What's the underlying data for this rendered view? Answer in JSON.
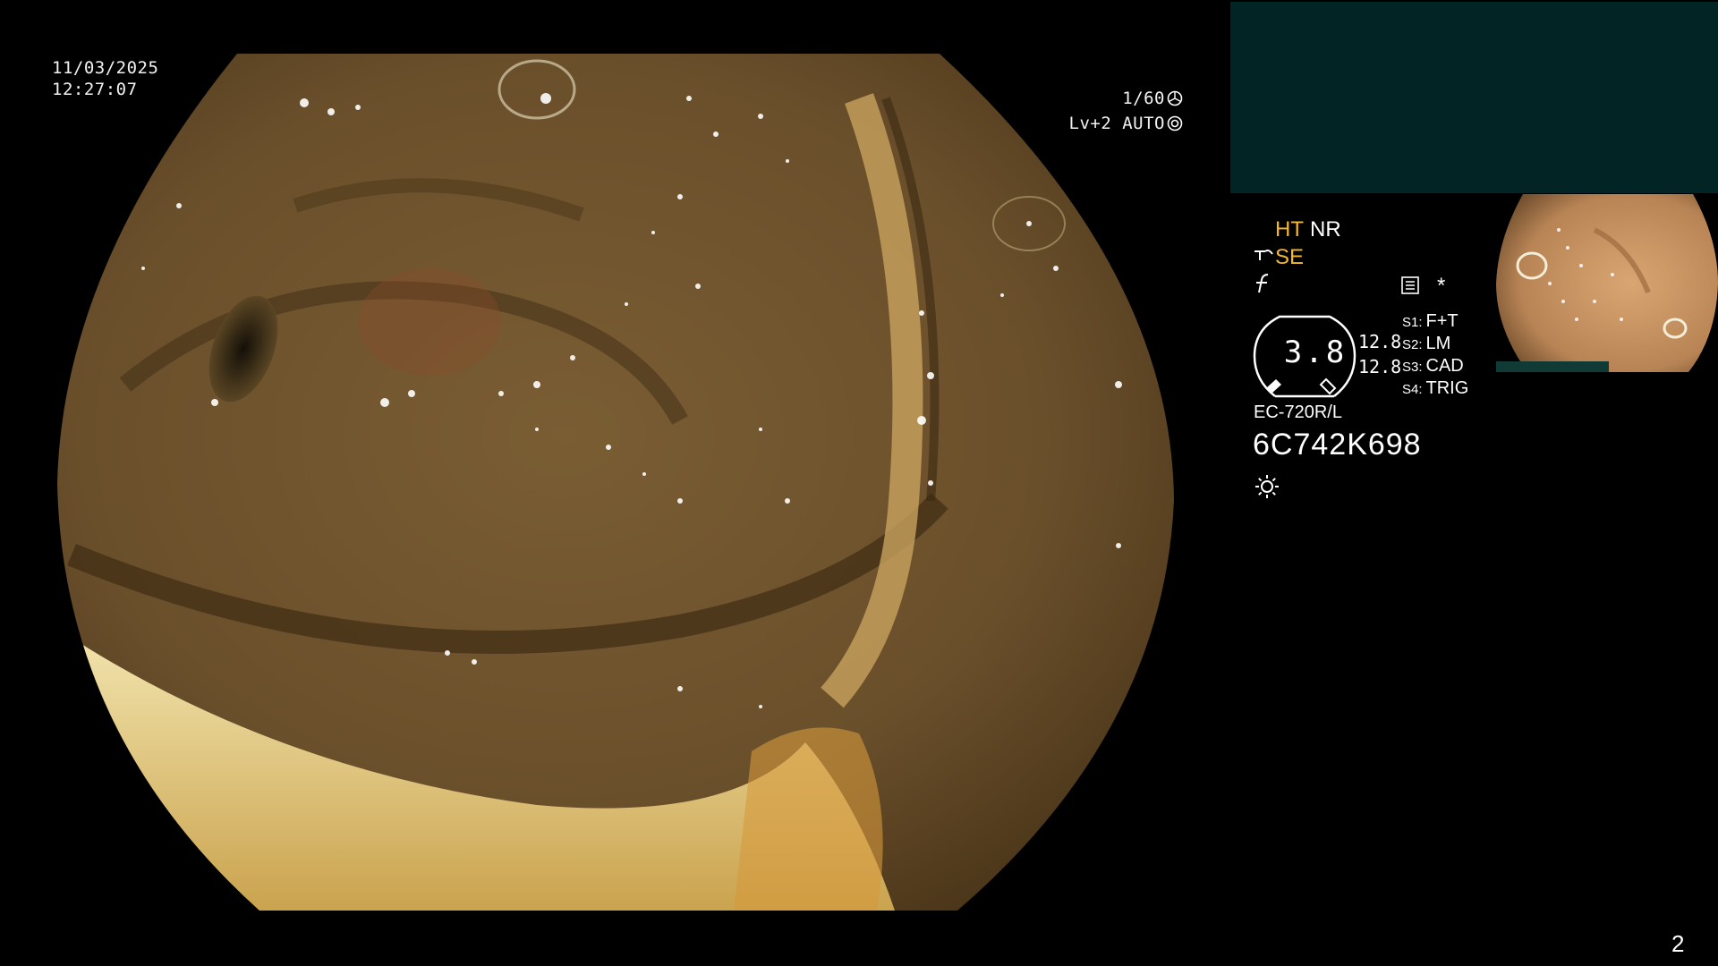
{
  "osd": {
    "date": "11/03/2025",
    "time": "12:27:07",
    "shutter": "1/60",
    "shutter_icon": "shutter-icon",
    "level": "Lv+2 AUTO",
    "auto_icon": "auto-iris-icon"
  },
  "panel": {
    "ht": "HT",
    "nr": "NR",
    "se": "SE",
    "se_icon": "structure-enhance-icon",
    "f_icon": "freeze-icon",
    "list_icon": "memo-icon",
    "asterisk": "*",
    "gauge_value": "3.8",
    "gauge_num_1": "12.8",
    "gauge_num_2": "12.8",
    "switches": [
      {
        "key": "S1:",
        "value": "F+T"
      },
      {
        "key": "S2:",
        "value": "LM"
      },
      {
        "key": "S3:",
        "value": "CAD"
      },
      {
        "key": "S4:",
        "value": "TRIG"
      }
    ],
    "model": "EC-720R/L",
    "serial": "6C742K698",
    "light_icon": "light-source-icon"
  },
  "page_number": "2",
  "colors": {
    "background": "#000000",
    "accent_orange": "#f5b82a",
    "panel_teal": "#022424"
  }
}
